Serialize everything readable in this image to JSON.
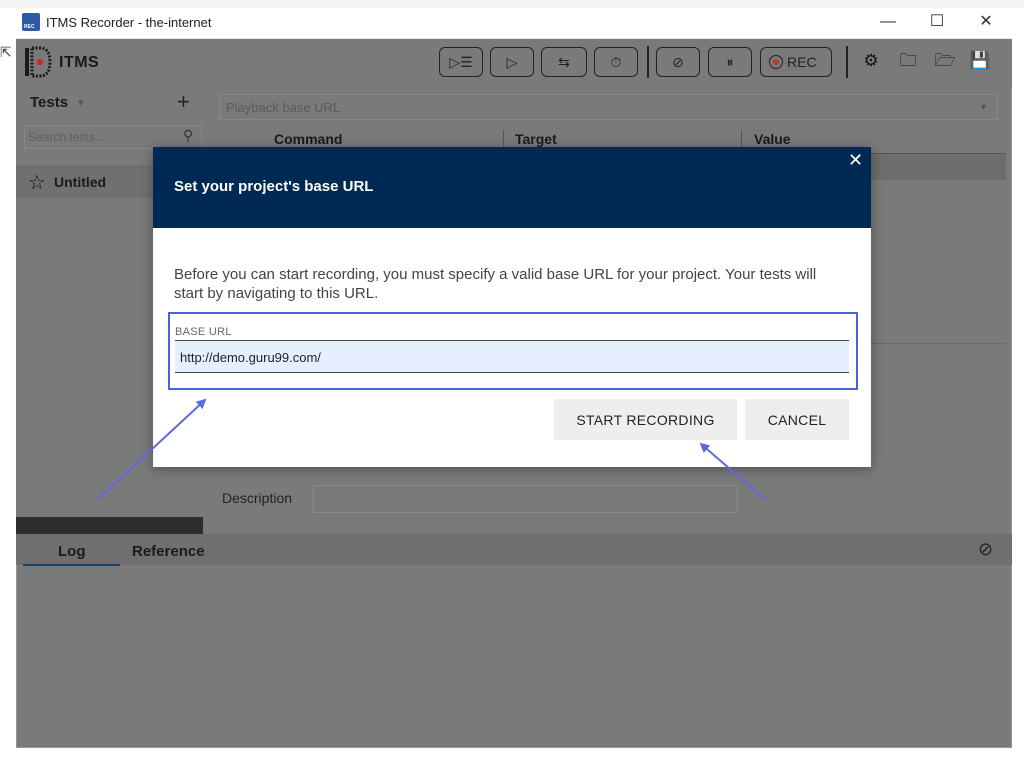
{
  "window": {
    "title": "ITMS Recorder - the-internet",
    "app_icon_text": "REC",
    "controls": {
      "minimize": "—",
      "maximize": "☐",
      "close": "✕"
    }
  },
  "toolbar": {
    "logo_text": "ITMS",
    "buttons": [
      {
        "name": "run-all-tests-button",
        "icon": "play-list-icon",
        "glyph": "▷☰"
      },
      {
        "name": "run-test-button",
        "icon": "play-icon",
        "glyph": "▷"
      },
      {
        "name": "step-button",
        "icon": "step-over-icon",
        "glyph": "⇆"
      },
      {
        "name": "speed-button",
        "icon": "stopwatch-icon",
        "glyph": "⏱"
      },
      {
        "name": "disable-breakpoints-button",
        "icon": "breakpoint-off-icon",
        "glyph": "⊘"
      },
      {
        "name": "pause-exceptions-button",
        "icon": "pause-circle-icon",
        "glyph": "⏸"
      }
    ],
    "rec_label": "REC",
    "right_icons": [
      {
        "name": "settings-icon",
        "glyph": "⚙"
      },
      {
        "name": "new-project-icon",
        "glyph": "🗀"
      },
      {
        "name": "open-project-icon",
        "glyph": "🗁"
      },
      {
        "name": "save-project-icon",
        "glyph": "💾"
      }
    ]
  },
  "sidebar": {
    "tests_label": "Tests",
    "add_label": "+",
    "search_placeholder": "Search tests...",
    "tests": [
      {
        "name": "Untitled"
      }
    ]
  },
  "editor": {
    "playback_placeholder": "Playback base URL",
    "columns": [
      "Command",
      "Target",
      "Value"
    ],
    "description_label": "Description"
  },
  "log_panel": {
    "tabs": [
      "Log",
      "Reference"
    ]
  },
  "modal": {
    "title": "Set your project's base URL",
    "message": "Before you can start recording, you must specify a valid base URL for your project. Your tests will start by navigating to this URL.",
    "field_label": "BASE URL",
    "field_value": "http://demo.guru99.com/",
    "start_label": "START RECORDING",
    "cancel_label": "CANCEL",
    "close_glyph": "✕"
  },
  "colors": {
    "modal_header": "#002a54",
    "field_highlight": "#4a63d8",
    "field_background": "#e6effd",
    "overlay_gray": "#7a7a7a"
  }
}
